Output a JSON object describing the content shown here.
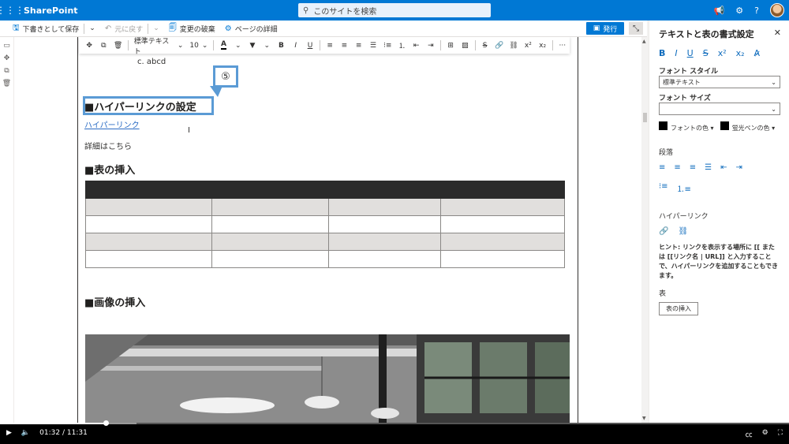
{
  "topbar": {
    "app_name": "SharePoint",
    "search_placeholder": "このサイトを検索",
    "icons": [
      "waffle-icon",
      "megaphone-icon",
      "gear-icon",
      "help-icon",
      "avatar"
    ]
  },
  "commandbar": {
    "save_draft": "下書きとして保存",
    "undo": "元に戻す",
    "discard": "変更の破棄",
    "page_details": "ページの詳細",
    "publish": "発行"
  },
  "format_toolbar": {
    "style": "標準テキスト",
    "size": "10",
    "more": "···"
  },
  "document": {
    "list_item": "c.  abcd",
    "callout_number": "⑤",
    "heading_hyperlink": "■ハイパーリンクの設定",
    "hyperlink_text": "ハイパーリンク",
    "details_text": "詳細はこちら",
    "heading_table": "■表の挿入",
    "heading_image": "■画像の挿入"
  },
  "pane": {
    "title": "テキストと表の書式設定",
    "font_style_label": "フォント スタイル",
    "font_style_value": "標準テキスト",
    "font_size_label": "フォント サイズ",
    "font_size_value": "",
    "font_color": "フォントの色",
    "highlight_color": "蛍光ペンの色",
    "paragraph_label": "段落",
    "hyperlink_label": "ハイパーリンク",
    "hint": "ヒント: リンクを表示する場所に [[ または [[リンク名 | URL]] と入力することで、ハイパーリンクを追加することもできます。",
    "table_label": "表",
    "insert_table": "表の挿入"
  },
  "video": {
    "current_time": "01:32",
    "separator": "/",
    "total_time": "11:31",
    "progress_fraction": 0.134,
    "buffered_fraction": 0.173
  },
  "colors": {
    "brand": "#0078d4",
    "heading_square": "#0f6cbd",
    "callout_border": "#5b9bd5"
  }
}
